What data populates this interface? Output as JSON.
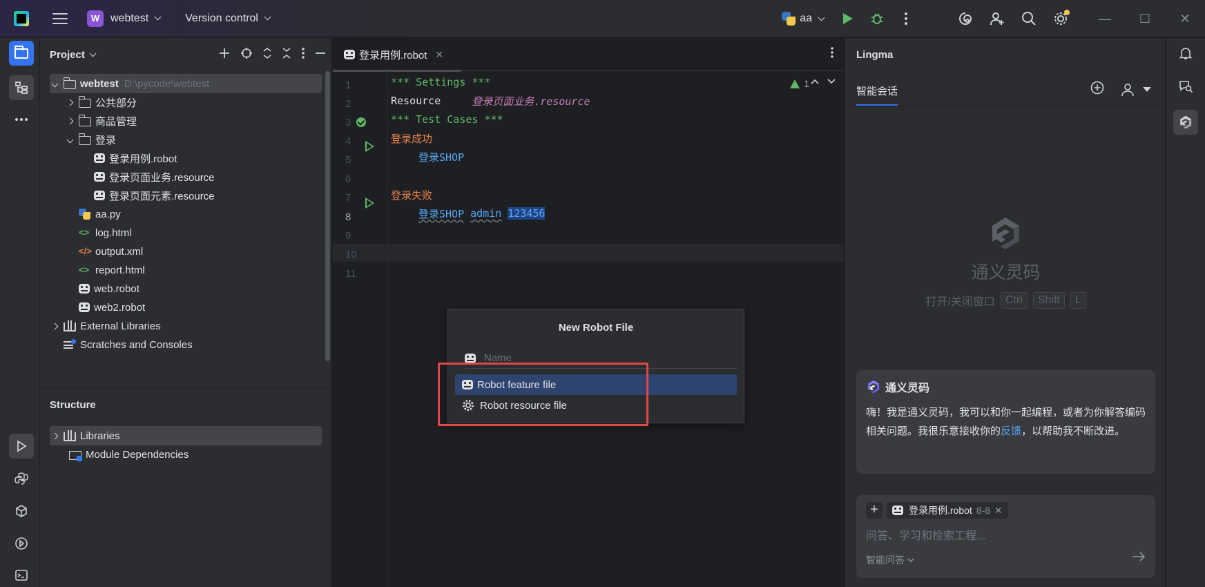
{
  "titlebar": {
    "project_badge": "W",
    "project_name": "webtest",
    "vcs_label": "Version control",
    "run_config": "aa",
    "window_minimize": "—",
    "window_maximize": "☐",
    "window_close": "✕"
  },
  "project_panel": {
    "title": "Project",
    "tree": [
      {
        "label": "webtest",
        "path": "D:\\pycode\\webtest",
        "icon": "folder-icon",
        "state": "expanded"
      },
      {
        "label": "公共部分",
        "icon": "folder-icon",
        "state": "collapsed"
      },
      {
        "label": "商品管理",
        "icon": "folder-icon",
        "state": "collapsed"
      },
      {
        "label": "登录",
        "icon": "folder-icon",
        "state": "expanded"
      },
      {
        "label": "登录用例.robot",
        "icon": "robot-file-icon"
      },
      {
        "label": "登录页面业务.resource",
        "icon": "robot-file-icon"
      },
      {
        "label": "登录页面元素.resource",
        "icon": "robot-file-icon"
      },
      {
        "label": "aa.py",
        "icon": "python-file-icon"
      },
      {
        "label": "log.html",
        "icon": "html-file-icon",
        "glyph": "<>"
      },
      {
        "label": "output.xml",
        "icon": "xml-file-icon",
        "glyph": "</>"
      },
      {
        "label": "report.html",
        "icon": "html-file-icon",
        "glyph": "<>"
      },
      {
        "label": "web.robot",
        "icon": "robot-file-icon"
      },
      {
        "label": "web2.robot",
        "icon": "robot-file-icon"
      },
      {
        "label": "External Libraries",
        "icon": "library-icon",
        "state": "collapsed"
      },
      {
        "label": "Scratches and Consoles",
        "icon": "scratches-icon"
      }
    ]
  },
  "structure_panel": {
    "title": "Structure",
    "items": [
      {
        "label": "Libraries",
        "icon": "library-icon",
        "state": "collapsed"
      },
      {
        "label": "Module Dependencies",
        "icon": "module-icon"
      }
    ]
  },
  "editor": {
    "tab_label": "登录用例.robot",
    "tab_close": "✕",
    "warning_count": "1",
    "line_numbers": [
      "1",
      "2",
      "3",
      "4",
      "5",
      "6",
      "7",
      "8",
      "9",
      "10",
      "11"
    ],
    "current_line": 8,
    "lines": {
      "l1": "*** Settings ***",
      "l2_kw": "Resource",
      "l2_val": "登录页面业务.resource",
      "l3": "*** Test Cases ***",
      "l4": "登录成功",
      "l5": "登录SHOP",
      "l7": "登录失败",
      "l8_call": "登录SHOP",
      "l8_arg1": "admin",
      "l8_arg2": "123456"
    }
  },
  "new_file_popup": {
    "title": "New Robot File",
    "name_placeholder": "Name",
    "options": [
      {
        "label": "Robot feature file",
        "icon": "robot-file-icon",
        "highlighted": true
      },
      {
        "label": "Robot resource file",
        "icon": "gear-icon",
        "highlighted": false
      }
    ],
    "highlight_color": "#e04848"
  },
  "lingma": {
    "title": "Lingma",
    "tab": "智能会话",
    "brand": "通义灵码",
    "shortcut_label": "打开/关闭窗口",
    "shortcut_keys": [
      "Ctrl",
      "Shift",
      "L"
    ],
    "card_title": "通义灵码",
    "card_text_before_link": "嗨！我是通义灵码，我可以和你一起编程，或者为你解答编码相关问题。我很乐意接收你的",
    "card_link": "反馈",
    "card_text_after_link": "，以帮助我不断改进。",
    "context_chip_file": "登录用例.robot",
    "context_chip_range": "8-8",
    "input_placeholder": "问答、学习和检索工程...",
    "mode_label": "智能问答"
  },
  "colors": {
    "accent": "#3574f0",
    "run_green": "#5fb865",
    "annotation_red": "#e04848",
    "project_badge": "#8b54d6"
  }
}
